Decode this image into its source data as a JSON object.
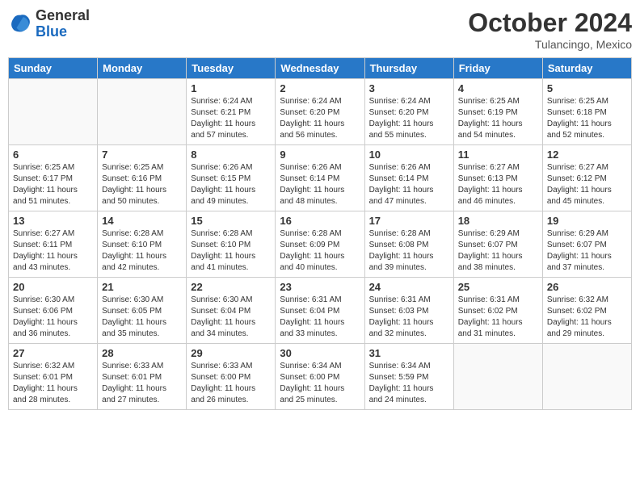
{
  "header": {
    "logo_general": "General",
    "logo_blue": "Blue",
    "month_year": "October 2024",
    "location": "Tulancingo, Mexico"
  },
  "days_of_week": [
    "Sunday",
    "Monday",
    "Tuesday",
    "Wednesday",
    "Thursday",
    "Friday",
    "Saturday"
  ],
  "weeks": [
    [
      {
        "day": "",
        "sunrise": "",
        "sunset": "",
        "daylight": ""
      },
      {
        "day": "",
        "sunrise": "",
        "sunset": "",
        "daylight": ""
      },
      {
        "day": "1",
        "sunrise": "Sunrise: 6:24 AM",
        "sunset": "Sunset: 6:21 PM",
        "daylight": "Daylight: 11 hours and 57 minutes."
      },
      {
        "day": "2",
        "sunrise": "Sunrise: 6:24 AM",
        "sunset": "Sunset: 6:20 PM",
        "daylight": "Daylight: 11 hours and 56 minutes."
      },
      {
        "day": "3",
        "sunrise": "Sunrise: 6:24 AM",
        "sunset": "Sunset: 6:20 PM",
        "daylight": "Daylight: 11 hours and 55 minutes."
      },
      {
        "day": "4",
        "sunrise": "Sunrise: 6:25 AM",
        "sunset": "Sunset: 6:19 PM",
        "daylight": "Daylight: 11 hours and 54 minutes."
      },
      {
        "day": "5",
        "sunrise": "Sunrise: 6:25 AM",
        "sunset": "Sunset: 6:18 PM",
        "daylight": "Daylight: 11 hours and 52 minutes."
      }
    ],
    [
      {
        "day": "6",
        "sunrise": "Sunrise: 6:25 AM",
        "sunset": "Sunset: 6:17 PM",
        "daylight": "Daylight: 11 hours and 51 minutes."
      },
      {
        "day": "7",
        "sunrise": "Sunrise: 6:25 AM",
        "sunset": "Sunset: 6:16 PM",
        "daylight": "Daylight: 11 hours and 50 minutes."
      },
      {
        "day": "8",
        "sunrise": "Sunrise: 6:26 AM",
        "sunset": "Sunset: 6:15 PM",
        "daylight": "Daylight: 11 hours and 49 minutes."
      },
      {
        "day": "9",
        "sunrise": "Sunrise: 6:26 AM",
        "sunset": "Sunset: 6:14 PM",
        "daylight": "Daylight: 11 hours and 48 minutes."
      },
      {
        "day": "10",
        "sunrise": "Sunrise: 6:26 AM",
        "sunset": "Sunset: 6:14 PM",
        "daylight": "Daylight: 11 hours and 47 minutes."
      },
      {
        "day": "11",
        "sunrise": "Sunrise: 6:27 AM",
        "sunset": "Sunset: 6:13 PM",
        "daylight": "Daylight: 11 hours and 46 minutes."
      },
      {
        "day": "12",
        "sunrise": "Sunrise: 6:27 AM",
        "sunset": "Sunset: 6:12 PM",
        "daylight": "Daylight: 11 hours and 45 minutes."
      }
    ],
    [
      {
        "day": "13",
        "sunrise": "Sunrise: 6:27 AM",
        "sunset": "Sunset: 6:11 PM",
        "daylight": "Daylight: 11 hours and 43 minutes."
      },
      {
        "day": "14",
        "sunrise": "Sunrise: 6:28 AM",
        "sunset": "Sunset: 6:10 PM",
        "daylight": "Daylight: 11 hours and 42 minutes."
      },
      {
        "day": "15",
        "sunrise": "Sunrise: 6:28 AM",
        "sunset": "Sunset: 6:10 PM",
        "daylight": "Daylight: 11 hours and 41 minutes."
      },
      {
        "day": "16",
        "sunrise": "Sunrise: 6:28 AM",
        "sunset": "Sunset: 6:09 PM",
        "daylight": "Daylight: 11 hours and 40 minutes."
      },
      {
        "day": "17",
        "sunrise": "Sunrise: 6:28 AM",
        "sunset": "Sunset: 6:08 PM",
        "daylight": "Daylight: 11 hours and 39 minutes."
      },
      {
        "day": "18",
        "sunrise": "Sunrise: 6:29 AM",
        "sunset": "Sunset: 6:07 PM",
        "daylight": "Daylight: 11 hours and 38 minutes."
      },
      {
        "day": "19",
        "sunrise": "Sunrise: 6:29 AM",
        "sunset": "Sunset: 6:07 PM",
        "daylight": "Daylight: 11 hours and 37 minutes."
      }
    ],
    [
      {
        "day": "20",
        "sunrise": "Sunrise: 6:30 AM",
        "sunset": "Sunset: 6:06 PM",
        "daylight": "Daylight: 11 hours and 36 minutes."
      },
      {
        "day": "21",
        "sunrise": "Sunrise: 6:30 AM",
        "sunset": "Sunset: 6:05 PM",
        "daylight": "Daylight: 11 hours and 35 minutes."
      },
      {
        "day": "22",
        "sunrise": "Sunrise: 6:30 AM",
        "sunset": "Sunset: 6:04 PM",
        "daylight": "Daylight: 11 hours and 34 minutes."
      },
      {
        "day": "23",
        "sunrise": "Sunrise: 6:31 AM",
        "sunset": "Sunset: 6:04 PM",
        "daylight": "Daylight: 11 hours and 33 minutes."
      },
      {
        "day": "24",
        "sunrise": "Sunrise: 6:31 AM",
        "sunset": "Sunset: 6:03 PM",
        "daylight": "Daylight: 11 hours and 32 minutes."
      },
      {
        "day": "25",
        "sunrise": "Sunrise: 6:31 AM",
        "sunset": "Sunset: 6:02 PM",
        "daylight": "Daylight: 11 hours and 31 minutes."
      },
      {
        "day": "26",
        "sunrise": "Sunrise: 6:32 AM",
        "sunset": "Sunset: 6:02 PM",
        "daylight": "Daylight: 11 hours and 29 minutes."
      }
    ],
    [
      {
        "day": "27",
        "sunrise": "Sunrise: 6:32 AM",
        "sunset": "Sunset: 6:01 PM",
        "daylight": "Daylight: 11 hours and 28 minutes."
      },
      {
        "day": "28",
        "sunrise": "Sunrise: 6:33 AM",
        "sunset": "Sunset: 6:01 PM",
        "daylight": "Daylight: 11 hours and 27 minutes."
      },
      {
        "day": "29",
        "sunrise": "Sunrise: 6:33 AM",
        "sunset": "Sunset: 6:00 PM",
        "daylight": "Daylight: 11 hours and 26 minutes."
      },
      {
        "day": "30",
        "sunrise": "Sunrise: 6:34 AM",
        "sunset": "Sunset: 6:00 PM",
        "daylight": "Daylight: 11 hours and 25 minutes."
      },
      {
        "day": "31",
        "sunrise": "Sunrise: 6:34 AM",
        "sunset": "Sunset: 5:59 PM",
        "daylight": "Daylight: 11 hours and 24 minutes."
      },
      {
        "day": "",
        "sunrise": "",
        "sunset": "",
        "daylight": ""
      },
      {
        "day": "",
        "sunrise": "",
        "sunset": "",
        "daylight": ""
      }
    ]
  ]
}
